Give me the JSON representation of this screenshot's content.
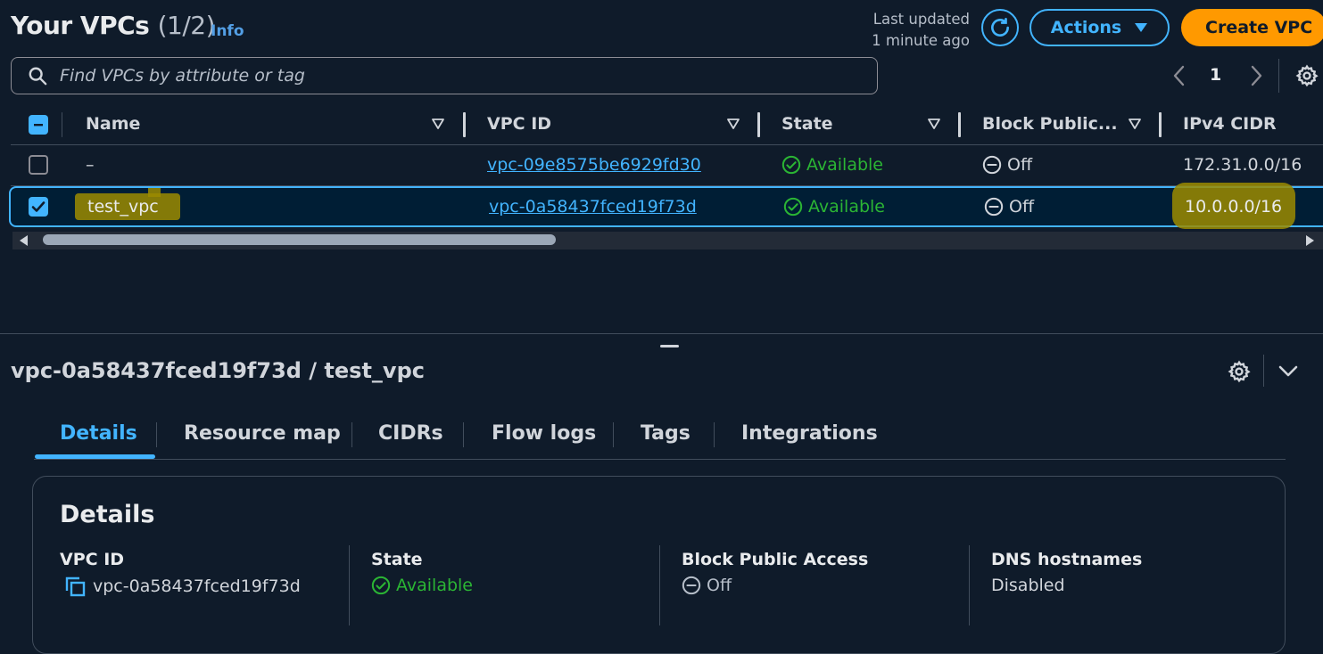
{
  "header": {
    "title": "Your VPCs",
    "count": "(1/2)",
    "info": "Info",
    "last_updated_line1": "Last updated",
    "last_updated_line2": "1 minute ago",
    "actions_label": "Actions",
    "create_label": "Create VPC"
  },
  "search": {
    "placeholder": "Find VPCs by attribute or tag"
  },
  "pager": {
    "page": "1"
  },
  "table": {
    "columns": [
      "Name",
      "VPC ID",
      "State",
      "Block Public...",
      "IPv4 CIDR"
    ],
    "rows": [
      {
        "name": "–",
        "vpc_id": "vpc-09e8575be6929fd30",
        "state": "Available",
        "block_public": "Off",
        "cidr": "172.31.0.0/16",
        "selected": false
      },
      {
        "name": "test_vpc",
        "vpc_id": "vpc-0a58437fced19f73d",
        "state": "Available",
        "block_public": "Off",
        "cidr": "10.0.0.0/16",
        "selected": true
      }
    ]
  },
  "detail": {
    "title": "vpc-0a58437fced19f73d / test_vpc",
    "tabs": [
      "Details",
      "Resource map",
      "CIDRs",
      "Flow logs",
      "Tags",
      "Integrations"
    ],
    "active_tab": "Details",
    "card_title": "Details",
    "fields": [
      {
        "label": "VPC ID",
        "value": "vpc-0a58437fced19f73d"
      },
      {
        "label": "State",
        "value": "Available"
      },
      {
        "label": "Block Public Access",
        "value": "Off"
      },
      {
        "label": "DNS hostnames",
        "value": "Disabled"
      }
    ]
  },
  "colors": {
    "accent": "#42b4ff",
    "primary": "#ff9900",
    "success": "#2bb534",
    "background": "#0f1b2a",
    "highlight": "#9b8b00"
  },
  "icons": [
    "search-icon",
    "refresh-icon",
    "caret-down-icon",
    "chevron-left-icon",
    "chevron-right-icon",
    "gear-icon",
    "sort-icon",
    "check-circle-icon",
    "minus-circle-icon",
    "copy-icon",
    "chevron-down-icon"
  ]
}
